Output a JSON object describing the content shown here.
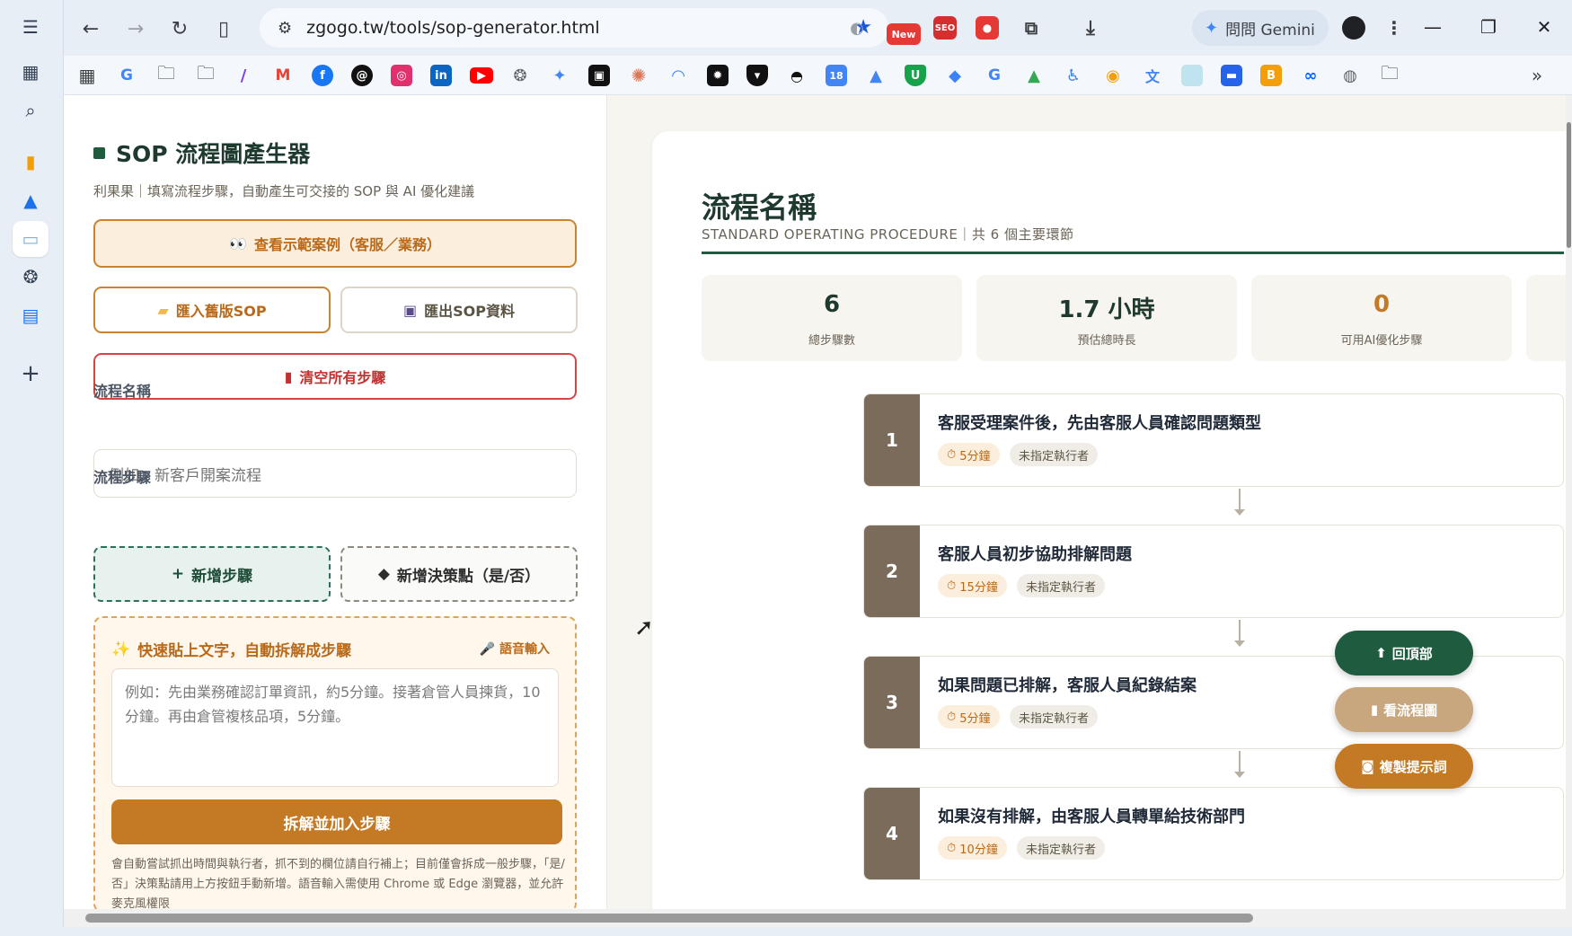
{
  "browser": {
    "url": "zgogo.tw/tools/sop-generator.html",
    "gemini_label": "問問 Gemini",
    "new_badge": "New"
  },
  "rail": {
    "items": [
      "menu-icon",
      "apps-icon",
      "search-icon",
      "chart-icon",
      "drive-icon",
      "image-icon",
      "openai-icon",
      "docs-icon",
      "plus-icon"
    ]
  },
  "bookmarks": {
    "items": [
      "apps-icon",
      "google",
      "folder G",
      "folder",
      "pen",
      "gmail",
      "facebook",
      "threads",
      "instagram",
      "linkedin",
      "youtube",
      "openai",
      "gemini",
      "notebook",
      "claude",
      "meta-ai",
      "sparkle",
      "shield",
      "vpn",
      "calendar",
      "ads",
      "shield-green",
      "diamond",
      "google",
      "drive",
      "accessibility",
      "chrome-logo",
      "translate",
      "image",
      "chat",
      "blogger",
      "meta",
      "globe",
      "folder Z"
    ],
    "more": "»"
  },
  "left": {
    "title": "SOP 流程圖產生器",
    "subtitle": "利果果｜填寫流程步驟，自動產生可交接的 SOP 與 AI 優化建議",
    "demo_button": "查看示範案例（客服／業務）",
    "import_button": "匯入舊版SOP",
    "export_button": "匯出SOP資料",
    "clear_button": "清空所有步驟",
    "process_name_label": "流程名稱",
    "process_name_placeholder": "例如：新客戶開案流程",
    "steps_label": "流程步驟",
    "add_step_button": "新增步驟",
    "add_decision_button": "新增決策點（是/否）",
    "quick_title": "快速貼上文字，自動拆解成步驟",
    "voice_button": "語音輸入",
    "quick_placeholder": "例如：先由業務確認訂單資訊，約5分鐘。接著倉管人員揀貨，10分鐘。再由倉管複核品項，5分鐘。",
    "split_button": "拆解並加入步驟",
    "quick_note": "會自動嘗試抓出時間與執行者，抓不到的欄位請自行補上；目前僅會拆成一般步驟，「是/否」決策點請用上方按鈕手動新增。語音輸入需使用 Chrome 或 Edge 瀏覽器，並允許麥克風權限"
  },
  "preview": {
    "title": "流程名稱",
    "subtitle": "STANDARD OPERATING PROCEDURE｜共 6 個主要環節",
    "stats": [
      {
        "value": "6",
        "label": "總步驟數"
      },
      {
        "value": "1.7 小時",
        "label": "預估總時長"
      },
      {
        "value": "0",
        "label": "可用AI優化步驟"
      }
    ],
    "steps": [
      {
        "num": "1",
        "title": "客服受理案件後，先由客服人員確認問題類型",
        "time": "5分鐘",
        "owner": "未指定執行者"
      },
      {
        "num": "2",
        "title": "客服人員初步協助排解問題",
        "time": "15分鐘",
        "owner": "未指定執行者"
      },
      {
        "num": "3",
        "title": "如果問題已排解，客服人員紀錄結案",
        "time": "5分鐘",
        "owner": "未指定執行者"
      },
      {
        "num": "4",
        "title": "如果沒有排解，由客服人員轉單給技術部門",
        "time": "10分鐘",
        "owner": "未指定執行者"
      }
    ]
  },
  "fabs": {
    "top": "回頂部",
    "flow": "看流程圖",
    "copy": "複製提示詞"
  },
  "colors": {
    "brand_green": "#1e5b3f",
    "accent_amber": "#c47a24",
    "danger": "#c53030",
    "step_number_bg": "#7b6b5a"
  }
}
